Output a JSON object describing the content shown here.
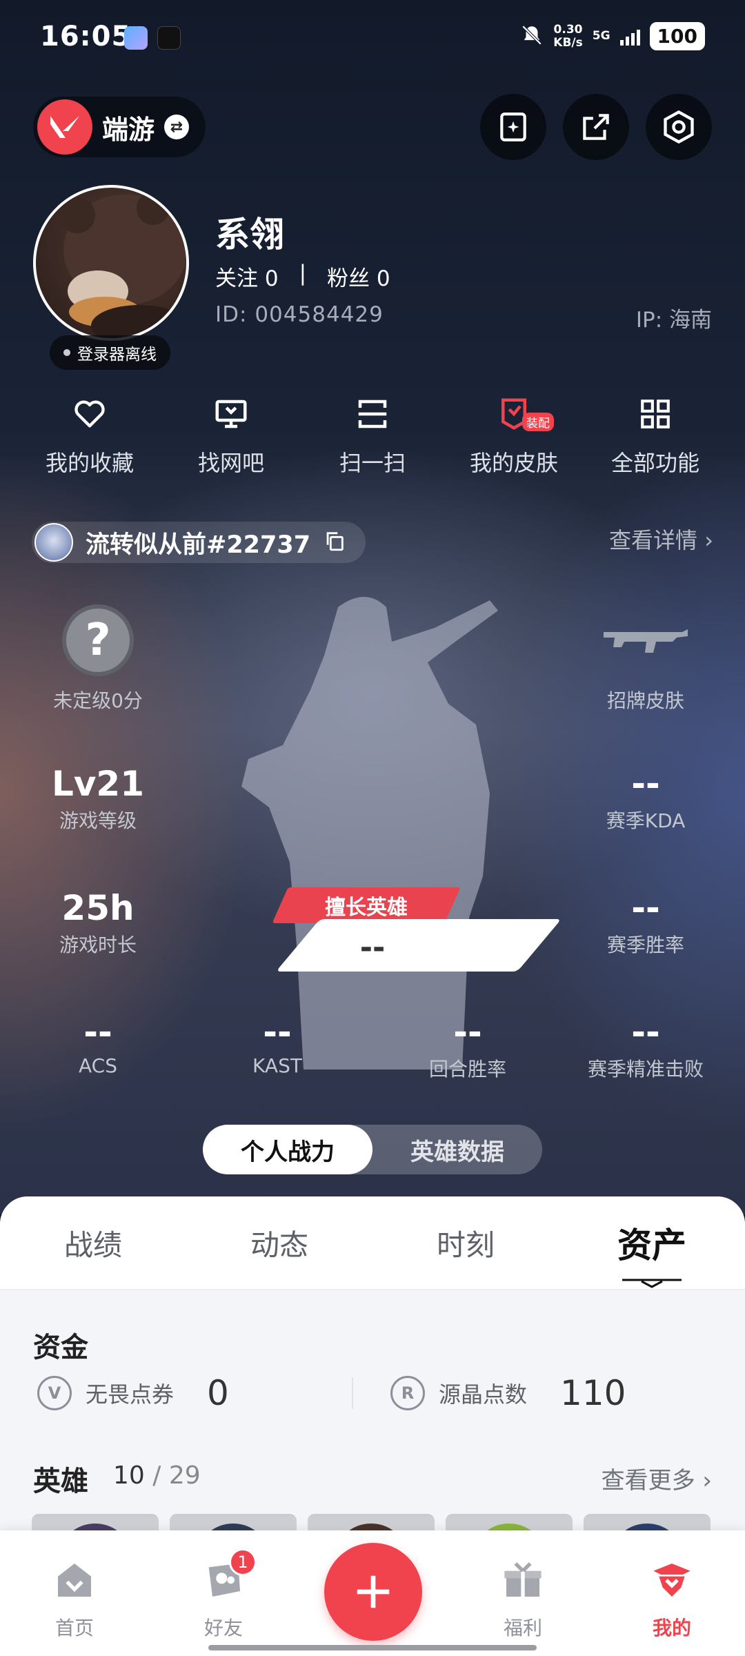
{
  "status_bar": {
    "time": "16:05",
    "net_speed": "0.30",
    "net_unit": "KB/s",
    "network": "5G",
    "battery": "100"
  },
  "header": {
    "game_name": "端游",
    "icons": [
      "ai-edit-icon",
      "share-icon",
      "settings-icon"
    ]
  },
  "profile": {
    "nickname": "系翎",
    "following_label": "关注",
    "following": "0",
    "separator": "|",
    "fans_label": "粉丝",
    "fans": "0",
    "id_label": "ID:",
    "id": "004584429",
    "ip_label": "IP:",
    "ip": "海南",
    "status": "登录器离线"
  },
  "shortcuts": [
    {
      "label": "我的收藏",
      "icon": "heart-icon"
    },
    {
      "label": "找网吧",
      "icon": "monitor-icon"
    },
    {
      "label": "扫一扫",
      "icon": "scan-icon"
    },
    {
      "label": "我的皮肤",
      "icon": "skin-icon",
      "badge": "装配"
    },
    {
      "label": "全部功能",
      "icon": "grid-icon"
    }
  ],
  "account": {
    "name": "流转似从前#22737",
    "detail_link": "查看详情",
    "icons": [
      "copy-icon",
      "chevron-right-icon"
    ]
  },
  "stats": {
    "rank": {
      "symbol": "?",
      "label": "未定级0分"
    },
    "signature_skin": {
      "label": "招牌皮肤"
    },
    "level": {
      "value": "Lv21",
      "label": "游戏等级"
    },
    "season_kda": {
      "value": "--",
      "label": "赛季KDA"
    },
    "playtime": {
      "value": "25h",
      "label": "游戏时长"
    },
    "season_winrate": {
      "value": "--",
      "label": "赛季胜率"
    },
    "best_hero": {
      "tag": "擅长英雄",
      "value": "--"
    },
    "acs": {
      "value": "--",
      "label": "ACS"
    },
    "kast": {
      "value": "--",
      "label": "KAST"
    },
    "round_winrate": {
      "value": "--",
      "label": "回合胜率"
    },
    "precise_kills": {
      "value": "--",
      "label": "赛季精准击败"
    }
  },
  "toggle": {
    "options": [
      "个人战力",
      "英雄数据"
    ],
    "selected": 0
  },
  "tabs": {
    "items": [
      "战绩",
      "动态",
      "时刻",
      "资产"
    ],
    "selected": 3
  },
  "assets": {
    "funds_title": "资金",
    "vp_label": "无畏点券",
    "vp_value": "0",
    "rp_label": "源晶点数",
    "rp_value": "110",
    "heroes_title": "英雄",
    "heroes_owned": "10",
    "heroes_sep": "/",
    "heroes_total": "29",
    "heroes_more": "查看更多",
    "hero_colors": [
      "#4a3f63",
      "#2f3d57",
      "#4a332b",
      "#8ab838",
      "#2b3f6e"
    ]
  },
  "bottom_nav": {
    "items": [
      {
        "label": "首页",
        "icon": "home-icon"
      },
      {
        "label": "好友",
        "icon": "friends-icon",
        "badge": "1"
      },
      {
        "label": "",
        "icon": "plus-icon"
      },
      {
        "label": "福利",
        "icon": "gift-icon"
      },
      {
        "label": "我的",
        "icon": "profile-icon"
      }
    ],
    "selected": 4
  },
  "colors": {
    "accent": "#f0434e",
    "sheet_bg": "#f4f5f8"
  }
}
